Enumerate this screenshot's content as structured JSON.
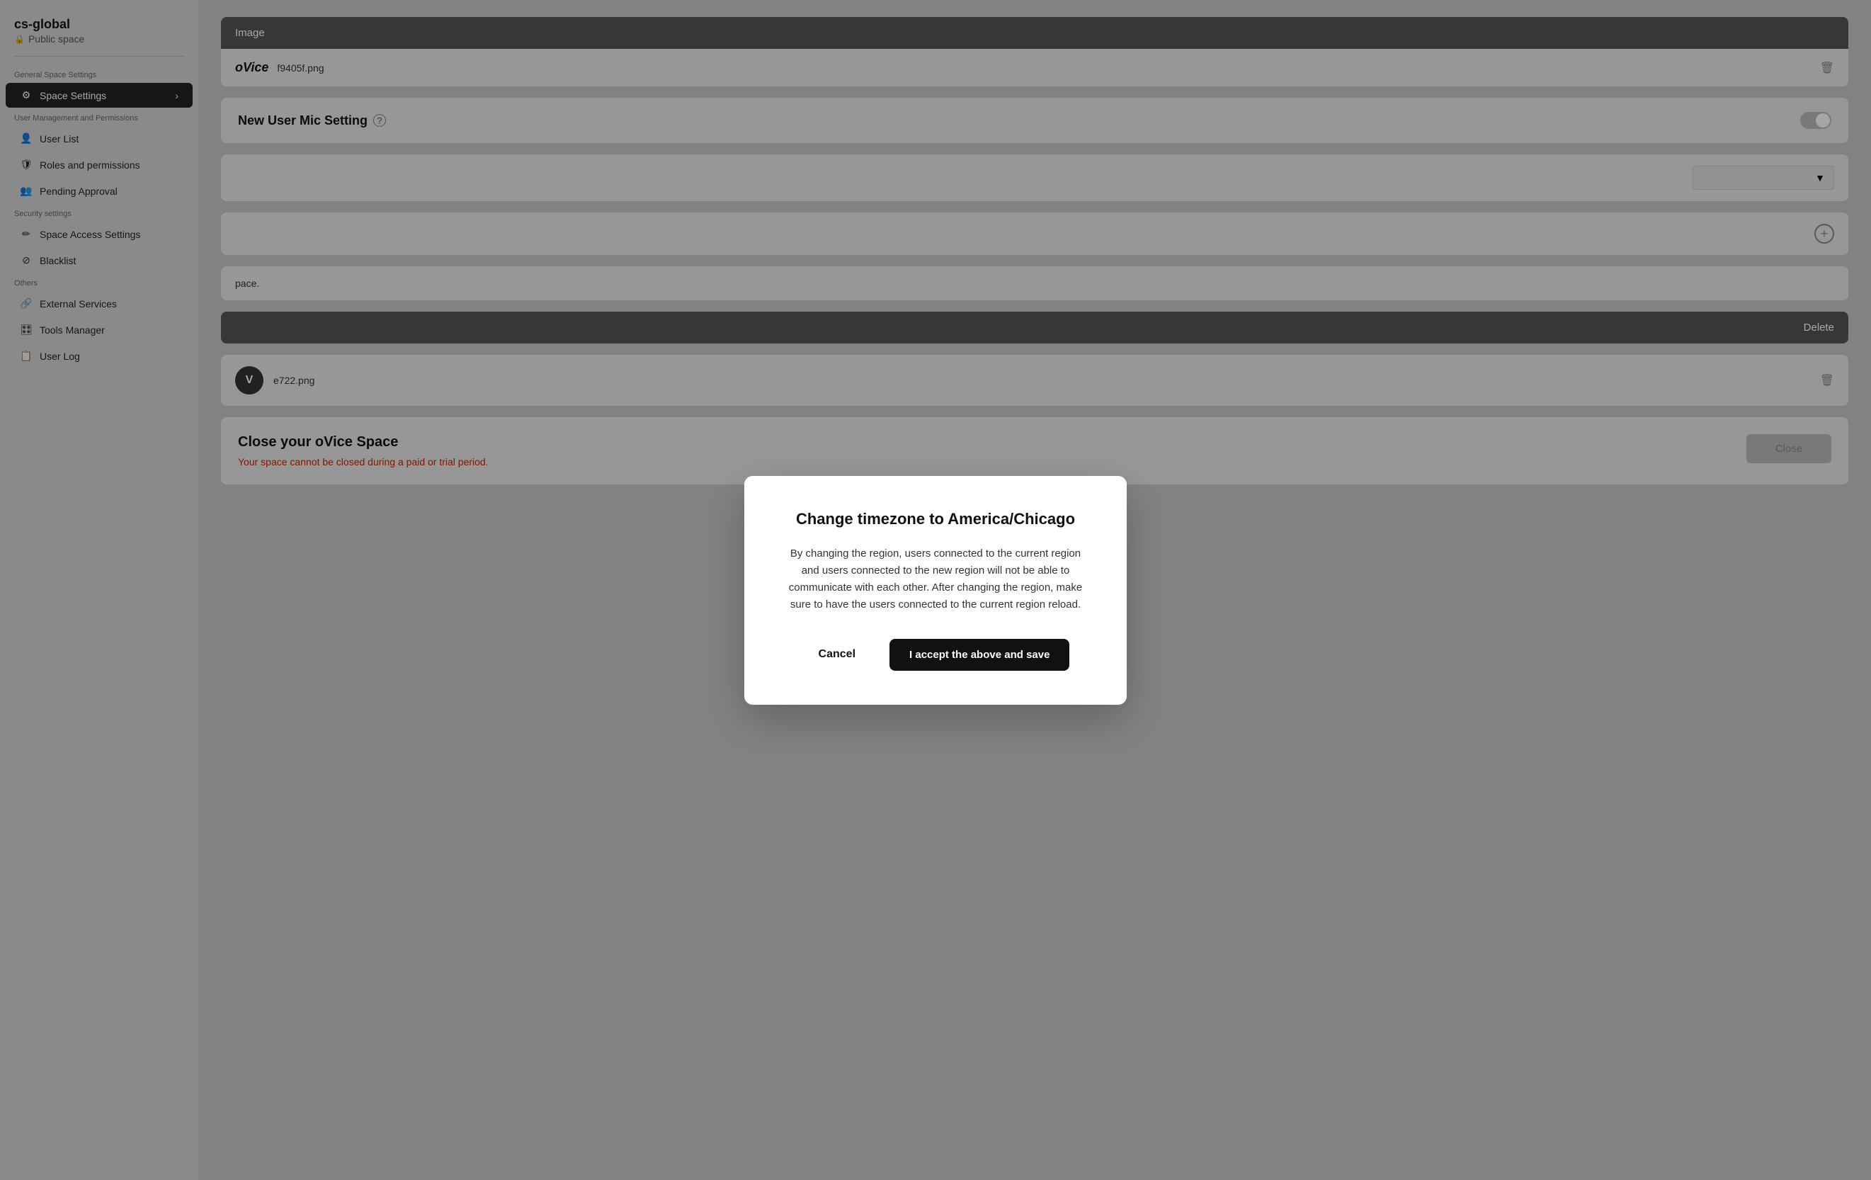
{
  "sidebar": {
    "workspace_name": "cs-global",
    "workspace_type": "Public space",
    "sections": [
      {
        "label": "General Space Settings",
        "items": [
          {
            "id": "space-settings",
            "icon": "⚙",
            "label": "Space Settings",
            "active": true,
            "hasArrow": true
          }
        ]
      },
      {
        "label": "User Management and Permissions",
        "items": [
          {
            "id": "user-list",
            "icon": "👤",
            "label": "User List",
            "active": false
          },
          {
            "id": "roles-permissions",
            "icon": "🛡",
            "label": "Roles and permissions",
            "active": false
          },
          {
            "id": "pending-approval",
            "icon": "👥",
            "label": "Pending Approval",
            "active": false
          }
        ]
      },
      {
        "label": "Security settings",
        "items": [
          {
            "id": "space-access-settings",
            "icon": "✏",
            "label": "Space Access Settings",
            "active": false
          },
          {
            "id": "blacklist",
            "icon": "⊘",
            "label": "Blacklist",
            "active": false
          }
        ]
      },
      {
        "label": "Others",
        "items": [
          {
            "id": "external-services",
            "icon": "🔗",
            "label": "External Services",
            "active": false
          },
          {
            "id": "tools-manager",
            "icon": "🎛",
            "label": "Tools Manager",
            "active": false
          },
          {
            "id": "user-log",
            "icon": "📋",
            "label": "User Log",
            "active": false
          }
        ]
      }
    ]
  },
  "main": {
    "image_section": {
      "header": "Image",
      "file_name": "f9405f.png",
      "logo_text": "oVice"
    },
    "mic_setting": {
      "label": "New User Mic Setting",
      "enabled": false
    },
    "space_text": "pace.",
    "avatar": {
      "initial": "V",
      "file_name": "e722.png"
    },
    "close_space": {
      "title": "Close your oVice Space",
      "warning": "Your space cannot be closed during a paid or trial period.",
      "button_label": "Close"
    }
  },
  "modal": {
    "title": "Change timezone to America/Chicago",
    "body": "By changing the region, users connected to the current region and users connected to the new region will not be able to communicate with each other. After changing the region, make sure to have the users connected to the current region reload.",
    "cancel_label": "Cancel",
    "confirm_label": "I accept the above and save"
  }
}
